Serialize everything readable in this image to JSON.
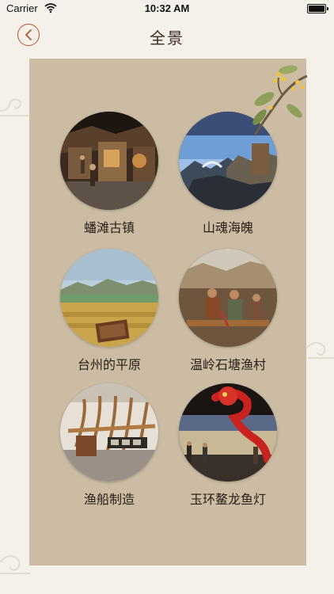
{
  "status_bar": {
    "carrier": "Carrier",
    "time": "10:32 AM"
  },
  "header": {
    "title": "全景",
    "back_icon": "chevron-left-icon",
    "accent_color": "#b5522b"
  },
  "panel": {
    "background_color": "#cbbca3",
    "items": [
      {
        "label": "蟠滩古镇"
      },
      {
        "label": "山魂海魄"
      },
      {
        "label": "台州的平原"
      },
      {
        "label": "温岭石塘渔村"
      },
      {
        "label": "渔船制造"
      },
      {
        "label": "玉环鳌龙鱼灯"
      }
    ]
  }
}
